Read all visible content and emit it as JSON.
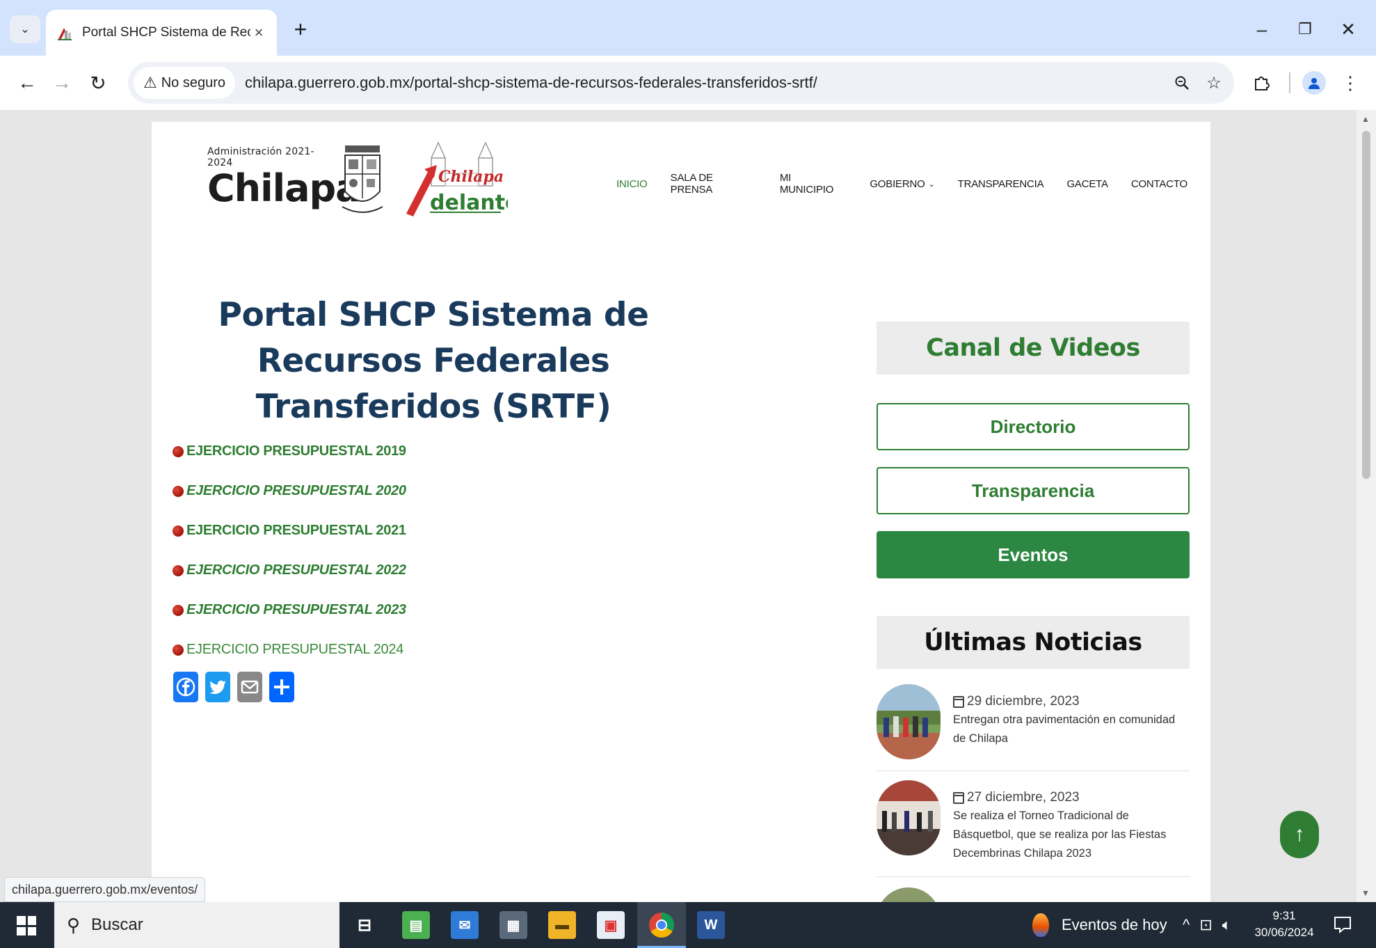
{
  "browser": {
    "tab_title": "Portal SHCP Sistema de Recurso",
    "tab_close": "×",
    "new_tab": "+",
    "window_min": "–",
    "window_restore": "❐",
    "window_close": "✕",
    "security_label": "No seguro",
    "url": "chilapa.guerrero.gob.mx/portal-shcp-sistema-de-recursos-federales-transferidos-srtf/",
    "status_url": "chilapa.guerrero.gob.mx/eventos/"
  },
  "header": {
    "admin_label": "Administración 2021-2024",
    "brand_name": "Chilapa",
    "adelante_top": "Chilapa",
    "adelante_bottom": "delante",
    "nav": [
      {
        "label": "INICIO",
        "active": true
      },
      {
        "label": "SALA DE PRENSA"
      },
      {
        "label": "MI MUNICIPIO"
      },
      {
        "label": "GOBIERNO",
        "dropdown": true
      },
      {
        "label": "TRANSPARENCIA"
      },
      {
        "label": "GACETA"
      },
      {
        "label": "CONTACTO"
      }
    ]
  },
  "main": {
    "title": "Portal SHCP Sistema de Recursos Federales Transferidos (SRTF)",
    "ejercicios": [
      {
        "label": "EJERCICIO PRESUPUESTAL 2019",
        "style": "bold"
      },
      {
        "label": "EJERCICIO PRESUPUESTAL 2020",
        "style": "bold-italic"
      },
      {
        "label": "EJERCICIO PRESUPUESTAL 2021",
        "style": "bold"
      },
      {
        "label": "EJERCICIO PRESUPUESTAL 2022",
        "style": "bold-italic"
      },
      {
        "label": "EJERCICIO PRESUPUESTAL 2023",
        "style": "bold-italic"
      },
      {
        "label": "EJERCICIO PRESUPUESTAL 2024",
        "style": "normal"
      }
    ],
    "share": [
      "facebook-icon",
      "twitter-icon",
      "email-icon",
      "share-icon"
    ]
  },
  "sidebar": {
    "canal_heading": "Canal de Videos",
    "btn_directorio": "Directorio",
    "btn_transparencia": "Transparencia",
    "btn_eventos": "Eventos",
    "noticias_heading": "Últimas Noticias",
    "news": [
      {
        "date": "29 diciembre, 2023",
        "title": "Entregan otra pavimentación en comunidad de Chilapa"
      },
      {
        "date": "27 diciembre, 2023",
        "title": "Se realiza el Torneo Tradicional de Básquetbol, que se realiza por las Fiestas Decembrinas Chilapa 2023"
      }
    ]
  },
  "colors": {
    "accent_green": "#2e7d32",
    "title_navy": "#1a3a5c",
    "bullet_red": "#a0140c"
  },
  "taskbar": {
    "search_label": "Buscar",
    "events_label": "Eventos de hoy",
    "time": "9:31",
    "date": "30/06/2024"
  }
}
